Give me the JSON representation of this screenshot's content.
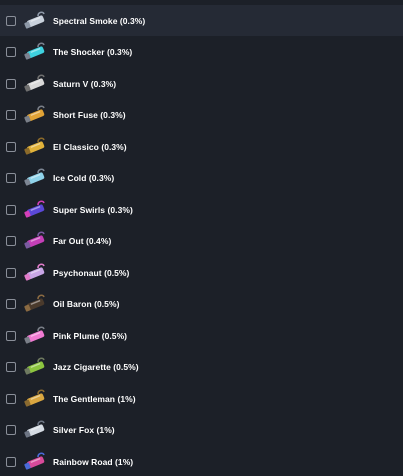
{
  "items": [
    {
      "label": "Spectral Smoke (0.3%)",
      "icon": "spectral-smoke-boost-icon",
      "color": "#c9d1dc",
      "accent": "#8e99a8",
      "checked": false
    },
    {
      "label": "The Shocker (0.3%)",
      "icon": "shocker-boost-icon",
      "color": "#3fd2e0",
      "accent": "#7b8290",
      "checked": false
    },
    {
      "label": "Saturn V (0.3%)",
      "icon": "saturn-v-boost-icon",
      "color": "#d9d9d9",
      "accent": "#6f6f6f",
      "checked": false
    },
    {
      "label": "Short Fuse (0.3%)",
      "icon": "short-fuse-boost-icon",
      "color": "#e0a235",
      "accent": "#7a7f88",
      "checked": false
    },
    {
      "label": "El Classico (0.3%)",
      "icon": "el-classico-boost-icon",
      "color": "#e1b23a",
      "accent": "#8b6a2a",
      "checked": false
    },
    {
      "label": "Ice Cold (0.3%)",
      "icon": "ice-cold-boost-icon",
      "color": "#8fd3ea",
      "accent": "#7d8694",
      "checked": false
    },
    {
      "label": "Super Swirls (0.3%)",
      "icon": "super-swirls-boost-icon",
      "color": "#5a48d8",
      "accent": "#d43fb8",
      "checked": false
    },
    {
      "label": "Far Out (0.4%)",
      "icon": "far-out-boost-icon",
      "color": "#c53fb8",
      "accent": "#7a5aa0",
      "checked": false
    },
    {
      "label": "Psychonaut (0.5%)",
      "icon": "psychonaut-boost-icon",
      "color": "#c9a6e6",
      "accent": "#e07bc9",
      "checked": false
    },
    {
      "label": "Oil Baron (0.5%)",
      "icon": "oil-baron-boost-icon",
      "color": "#4a3a2c",
      "accent": "#8a6a42",
      "checked": false
    },
    {
      "label": "Pink Plume (0.5%)",
      "icon": "pink-plume-boost-icon",
      "color": "#f07ad2",
      "accent": "#7a7f88",
      "checked": false
    },
    {
      "label": "Jazz Cigarette (0.5%)",
      "icon": "jazz-cigarette-boost-icon",
      "color": "#8cc43f",
      "accent": "#6f7a60",
      "checked": false
    },
    {
      "label": "The Gentleman (1%)",
      "icon": "gentleman-boost-icon",
      "color": "#d9a640",
      "accent": "#8a6a30",
      "checked": false
    },
    {
      "label": "Silver Fox (1%)",
      "icon": "silver-fox-boost-icon",
      "color": "#d5dbe3",
      "accent": "#6d7584",
      "checked": false
    },
    {
      "label": "Rainbow Road (1%)",
      "icon": "rainbow-road-boost-icon",
      "color": "#d84a9a",
      "accent": "#4a6ad8",
      "checked": false
    }
  ]
}
